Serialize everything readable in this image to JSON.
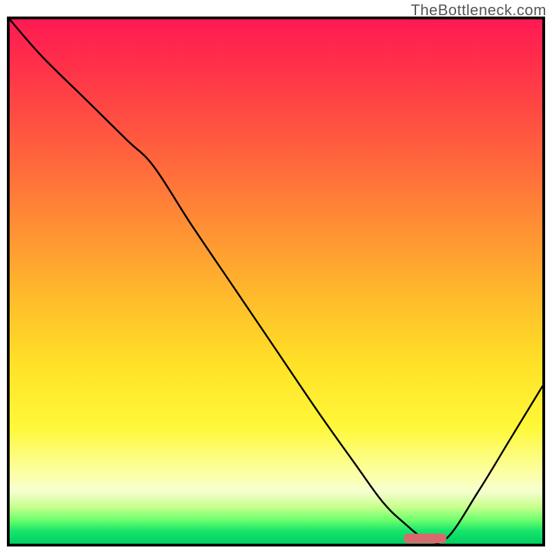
{
  "watermark": "TheBottleneck.com",
  "chart_data": {
    "type": "line",
    "title": "",
    "xlabel": "",
    "ylabel": "",
    "xlim": [
      0,
      100
    ],
    "ylim": [
      0,
      100
    ],
    "grid": false,
    "legend": false,
    "series": [
      {
        "name": "bottleneck-curve",
        "x": [
          0,
          6,
          14,
          22,
          27,
          34,
          42,
          50,
          58,
          65,
          70,
          74,
          78,
          82,
          88,
          94,
          100
        ],
        "y": [
          100,
          93,
          85,
          77,
          72,
          61,
          49,
          37,
          25,
          15,
          8,
          4,
          1,
          1,
          10,
          20,
          30
        ]
      }
    ],
    "marker": {
      "name": "optimal-range",
      "x_start": 74,
      "x_end": 82,
      "y": 1,
      "color": "#d86a6f"
    },
    "background_gradient": {
      "stops": [
        {
          "pos": 0.0,
          "color": "#ff1a53"
        },
        {
          "pos": 0.22,
          "color": "#ff5740"
        },
        {
          "pos": 0.52,
          "color": "#ffb82c"
        },
        {
          "pos": 0.78,
          "color": "#fff83a"
        },
        {
          "pos": 0.9,
          "color": "#f7ffd0"
        },
        {
          "pos": 0.97,
          "color": "#18e66b"
        },
        {
          "pos": 1.0,
          "color": "#00cf63"
        }
      ]
    }
  }
}
